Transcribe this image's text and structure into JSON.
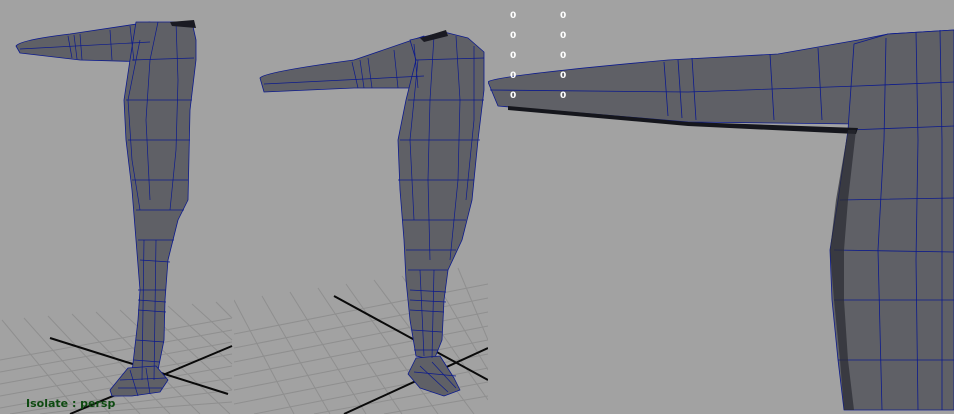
{
  "viewports": {
    "isolate_label": "Isolate : persp",
    "colors": {
      "background": "#a2a2a2",
      "grid": "#8f8f8f",
      "grid_axis": "#0a0a0a",
      "mesh_fill": "#5f6066",
      "mesh_wire": "#0c1a8c",
      "label": "#0d4a10",
      "hud_text": "#ffffff"
    }
  },
  "hud": {
    "stat_rows": [
      {
        "col1": "0",
        "col2": "0"
      },
      {
        "col1": "0",
        "col2": "0"
      },
      {
        "col1": "0",
        "col2": "0"
      },
      {
        "col1": "0",
        "col2": "0"
      },
      {
        "col1": "0",
        "col2": "0"
      }
    ]
  }
}
